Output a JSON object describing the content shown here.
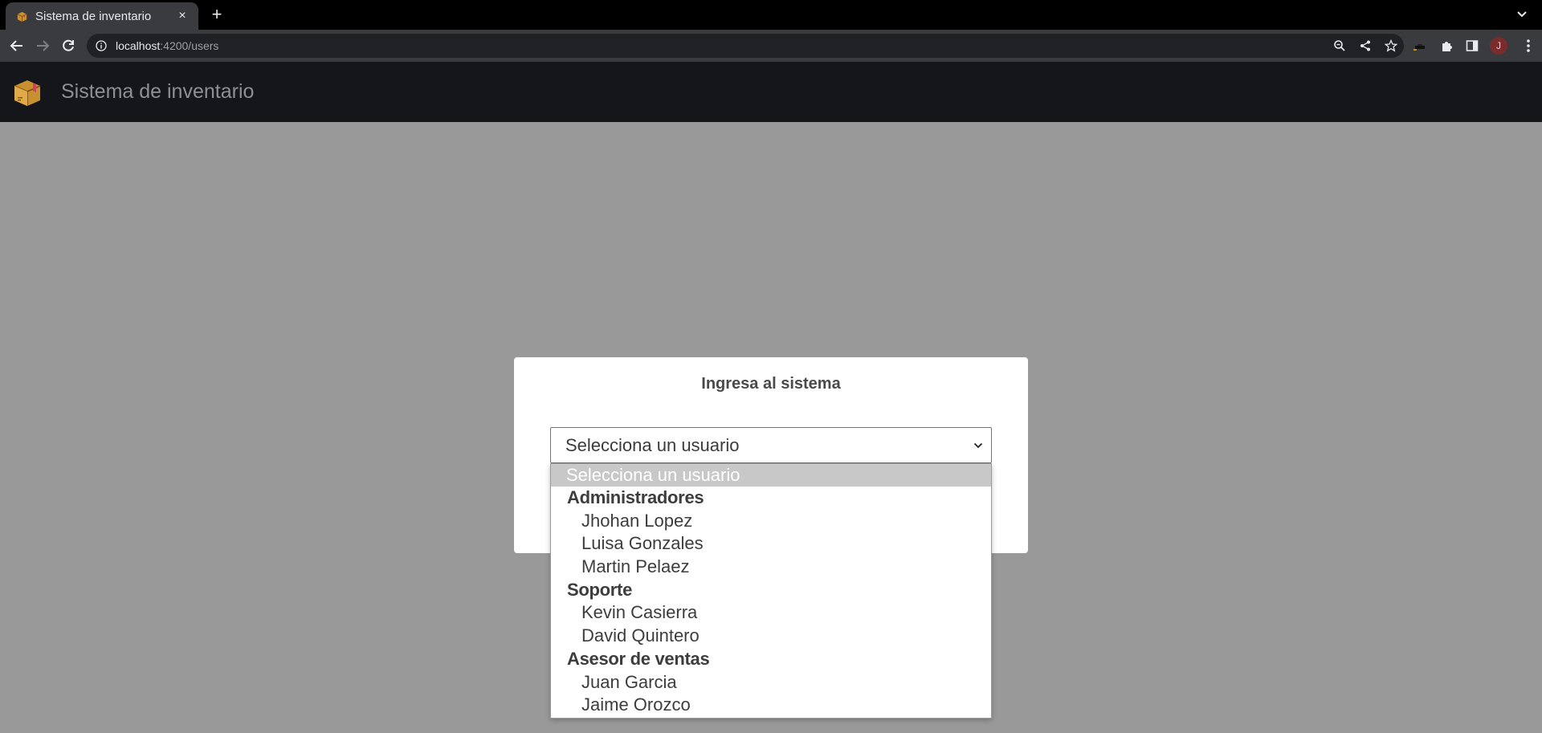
{
  "browser": {
    "tab_title": "Sistema de inventario",
    "tab_close": "×",
    "new_tab": "+",
    "url_host": "localhost",
    "url_rest": ":4200/users",
    "profile_initial": "J"
  },
  "app": {
    "title": "Sistema de inventario"
  },
  "login": {
    "heading": "Ingresa al sistema",
    "select_value": "Selecciona un usuario"
  },
  "dropdown": {
    "placeholder": "Selecciona un usuario",
    "groups": [
      {
        "label": "Administradores",
        "options": [
          "Jhohan Lopez",
          "Luisa Gonzales",
          "Martin Pelaez"
        ]
      },
      {
        "label": "Soporte",
        "options": [
          "Kevin Casierra",
          "David Quintero"
        ]
      },
      {
        "label": "Asesor de ventas",
        "options": [
          "Juan Garcia",
          "Jaime Orozco"
        ]
      }
    ]
  },
  "colors": {
    "page_background": "#999999",
    "header_background": "#15161a",
    "highlight": "#c8c8c8"
  }
}
